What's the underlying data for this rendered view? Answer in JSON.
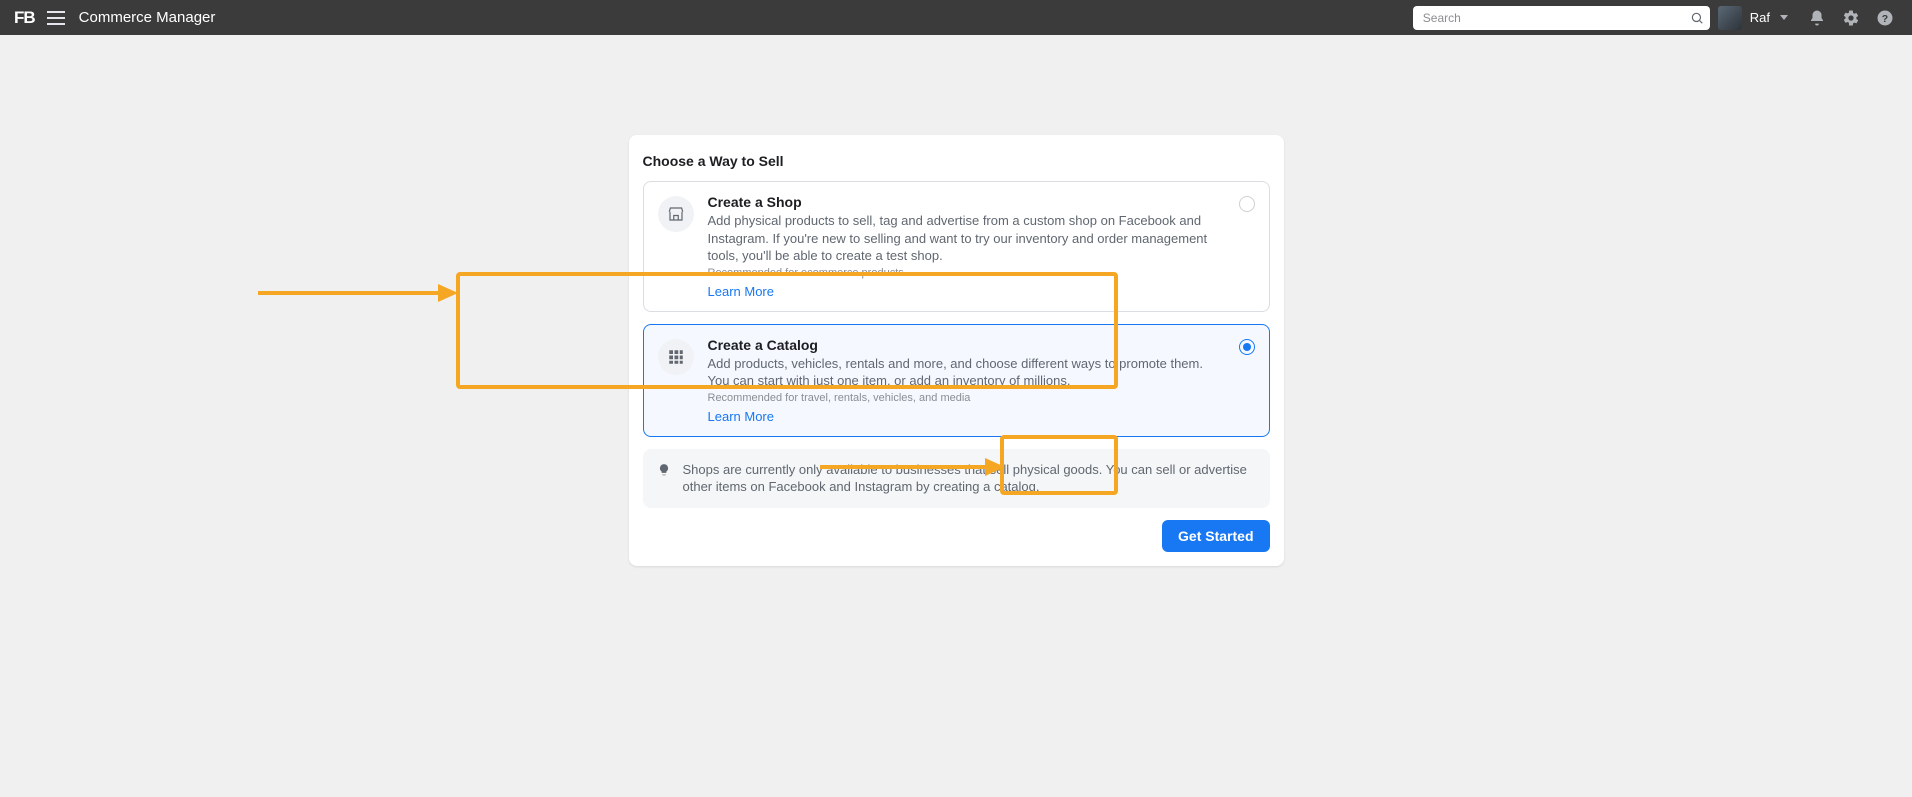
{
  "header": {
    "logo": "FB",
    "app_title": "Commerce Manager",
    "search_placeholder": "Search",
    "username": "Raf"
  },
  "card": {
    "title": "Choose a Way to Sell",
    "options": [
      {
        "title": "Create a Shop",
        "desc": "Add physical products to sell, tag and advertise from a custom shop on Facebook and Instagram. If you're new to selling and want to try our inventory and order management tools, you'll be able to create a test shop.",
        "recommended": "Recommended for ecommerce products",
        "learn": "Learn More"
      },
      {
        "title": "Create a Catalog",
        "desc": "Add products, vehicles, rentals and more, and choose different ways to promote them. You can start with just one item, or add an inventory of millions.",
        "recommended": "Recommended for travel, rentals, vehicles, and media",
        "learn": "Learn More"
      }
    ],
    "info": "Shops are currently only available to businesses that sell physical goods. You can sell or advertise other items on Facebook and Instagram by creating a catalog.",
    "cta": "Get Started"
  },
  "annotation_color": "#f5a623"
}
